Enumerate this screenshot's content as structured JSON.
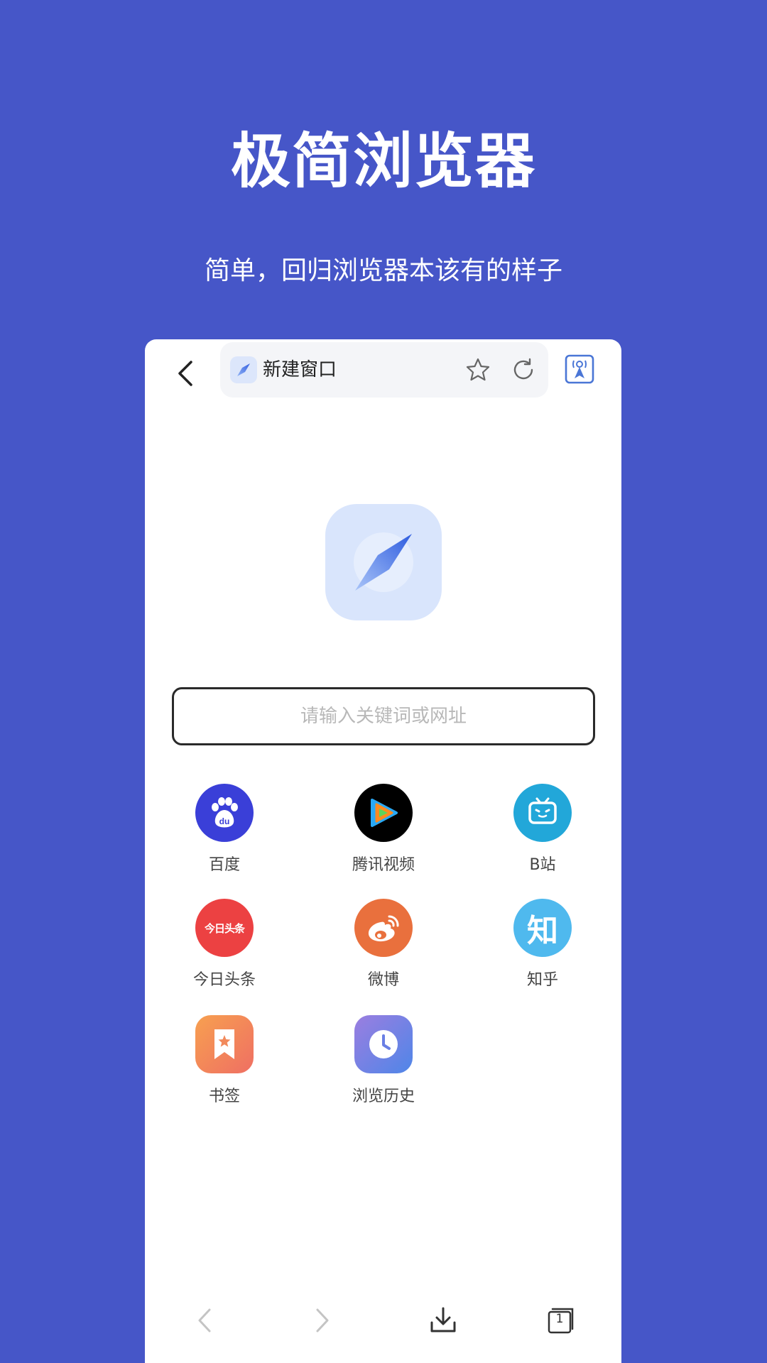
{
  "promo": {
    "title": "极简浏览器",
    "subtitle": "简单，回归浏览器本该有的样子"
  },
  "toolbar": {
    "tab_title": "新建窗口"
  },
  "search": {
    "placeholder": "请输入关键词或网址"
  },
  "shortcuts": [
    {
      "label": "百度",
      "icon": "baidu-icon",
      "color": "#3a3fd8"
    },
    {
      "label": "腾讯视频",
      "icon": "tencent-video-icon",
      "color": "#000000"
    },
    {
      "label": "B站",
      "icon": "bilibili-icon",
      "color": "#22a7d9"
    },
    {
      "label": "今日头条",
      "icon": "toutiao-icon",
      "color": "#ec4142"
    },
    {
      "label": "微博",
      "icon": "weibo-icon",
      "color": "#e9703d"
    },
    {
      "label": "知乎",
      "icon": "zhihu-icon",
      "color": "#4fb9ee",
      "glyph": "知"
    },
    {
      "label": "书签",
      "icon": "bookmark-icon",
      "color": "#f58a56"
    },
    {
      "label": "浏览历史",
      "icon": "history-icon",
      "color": "#7c80e8"
    }
  ],
  "toutiao_glyph": "今日头条",
  "bottom_bar": {
    "tab_count": "1"
  }
}
